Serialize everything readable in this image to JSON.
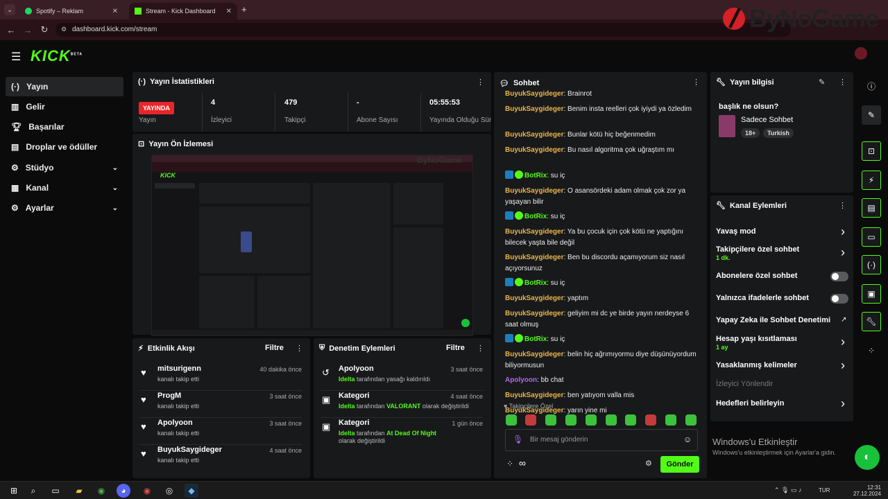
{
  "browser": {
    "tabs": [
      {
        "label": "Spotify – Reklam"
      },
      {
        "label": "Stream - Kick Dashboard"
      }
    ],
    "new_tab": "+",
    "url": "dashboard.kick.com/stream",
    "watermark": "ByNoGame"
  },
  "header": {
    "logo": "KICK",
    "logo_beta": "BETA"
  },
  "sidebar": {
    "items": [
      {
        "label": "Yayın",
        "icon": "broadcast-icon"
      },
      {
        "label": "Gelir",
        "icon": "revenue-icon"
      },
      {
        "label": "Başarılar",
        "icon": "trophy-icon"
      },
      {
        "label": "Droplar ve ödüller",
        "icon": "gift-icon"
      },
      {
        "label": "Stüdyo",
        "icon": "studio-icon"
      },
      {
        "label": "Kanal",
        "icon": "channel-icon"
      },
      {
        "label": "Ayarlar",
        "icon": "gear-icon"
      }
    ]
  },
  "stats": {
    "title": "Yayın İstatistikleri",
    "live_badge": "YAYINDA",
    "stream_label": "Yayın",
    "viewers": {
      "value": "4",
      "label": "İzleyici"
    },
    "followers": {
      "value": "479",
      "label": "Takipçi"
    },
    "subs": {
      "value": "-",
      "label": "Abone Sayısı"
    },
    "uptime": {
      "value": "05:55:53",
      "label": "Yayında Olduğu Süre"
    }
  },
  "preview": {
    "title": "Yayın Ön İzlemesi"
  },
  "activity": {
    "title": "Etkinlik Akışı",
    "filter": "Filtre",
    "items": [
      {
        "name": "mitsurigenn",
        "action": "kanalı takip etti",
        "time": "40 dakika önce"
      },
      {
        "name": "ProgM",
        "action": "kanalı takip etti",
        "time": "3 saat önce"
      },
      {
        "name": "Apolyoon",
        "action": "kanalı takip etti",
        "time": "3 saat önce"
      },
      {
        "name": "BuyukSaygideger",
        "action": "kanalı takip etti",
        "time": "4 saat önce"
      }
    ]
  },
  "moderation": {
    "title": "Denetim Eylemleri",
    "filter": "Filtre",
    "items": [
      {
        "name": "Apolyoon",
        "by": "Idelta",
        "rest": " tarafından yasağı kaldırıldı",
        "highlight": "",
        "tail": "",
        "time": "3 saat önce"
      },
      {
        "name": "Kategori",
        "by": "Idelta",
        "rest": " tarafından ",
        "highlight": "VALORANT",
        "tail": " olarak değiştirildi",
        "time": "4 saat önce"
      },
      {
        "name": "Kategori",
        "by": "Idelta",
        "rest": " tarafından ",
        "highlight": "At Dead Of Night",
        "tail": " olarak değiştirildi",
        "time": "1 gün önce"
      }
    ]
  },
  "chat": {
    "title": "Sohbet",
    "messages": [
      {
        "user": "BuyukSaygideger",
        "text": "Brainrot",
        "type": "u"
      },
      {
        "user": "BuyukSaygideger",
        "text": "Benim insta reelleri çok iyiydi ya özledim",
        "type": "u"
      },
      {
        "user": "BuyukSaygideger",
        "text": "Bunlar kötü hiç beğenmedim",
        "type": "u"
      },
      {
        "user": "BuyukSaygideger",
        "text": "Bu nasıl algoritma çok uğraştım mı",
        "type": "u"
      },
      {
        "user": "BotRix",
        "text": "su iç",
        "type": "b"
      },
      {
        "user": "BuyukSaygideger",
        "text": "O asansördeki adam olmak çok zor ya yaşayan bilir",
        "type": "u"
      },
      {
        "user": "BotRix",
        "text": "su iç",
        "type": "b"
      },
      {
        "user": "BuyukSaygideger",
        "text": "Ya bu çocuk için çok kötü ne yaptığını bilecek yaşta bile değil",
        "type": "u"
      },
      {
        "user": "BuyukSaygideger",
        "text": "Ben bu discordu açamıyorum siz nasıl açıyorsunuz",
        "type": "u"
      },
      {
        "user": "BotRix",
        "text": "su iç",
        "type": "b"
      },
      {
        "user": "BuyukSaygideger",
        "text": "yaptım",
        "type": "u"
      },
      {
        "user": "BuyukSaygideger",
        "text": "geliyim mi dc ye birde yayın nerdeyse 6 saat olmuş",
        "type": "u"
      },
      {
        "user": "BotRix",
        "text": "su iç",
        "type": "b"
      },
      {
        "user": "BuyukSaygideger",
        "text": "belin hiç ağrımıyormu diye düşünüyordum biliyormusun",
        "type": "u"
      },
      {
        "user": "Apolyoon",
        "text": "bb chat",
        "type": "p"
      },
      {
        "user": "BuyukSaygideger",
        "text": "ben yatıyom valla mis",
        "type": "u"
      },
      {
        "user": "BuyukSaygideger",
        "text": "yarın yine mi",
        "type": "u"
      }
    ],
    "followers_only": "Takipçilere Özel",
    "placeholder": "Bir mesaj gönderin",
    "send": "Gönder",
    "infinity": "∞"
  },
  "stream_info": {
    "title": "Yayın bilgisi",
    "stream_title": "başlık ne olsun?",
    "category": "Sadece Sohbet",
    "tags": [
      "18+",
      "Turkish"
    ]
  },
  "channel_actions": {
    "title": "Kanal Eylemleri",
    "items": [
      {
        "label": "Yavaş mod",
        "sub": "",
        "control": "chevron"
      },
      {
        "label": "Takipçilere özel sohbet",
        "sub": "1 dk.",
        "control": "chevron"
      },
      {
        "label": "Abonelere özel sohbet",
        "sub": "",
        "control": "toggle"
      },
      {
        "label": "Yalnızca ifadelerle sohbet",
        "sub": "",
        "control": "toggle"
      },
      {
        "label": "Yapay Zeka ile Sohbet Denetimi",
        "sub": "",
        "control": "external"
      },
      {
        "label": "Hesap yaşı kısıtlaması",
        "sub": "1 ay",
        "control": "chevron"
      },
      {
        "label": "Yasaklanmış kelimeler",
        "sub": "",
        "control": "chevron"
      },
      {
        "label": "İzleyici Yönlendir",
        "sub": "",
        "control": "none"
      },
      {
        "label": "Hedefleri belirleyin",
        "sub": "",
        "control": "chevron"
      }
    ]
  },
  "windows": {
    "activate_title": "Windows'u Etkinleştir",
    "activate_sub": "Windows'u etkinleştirmek için Ayarlar'a gidin.",
    "lang": "TUR",
    "time": "12:31",
    "date": "27.12.2024"
  },
  "colors": {
    "accent": "#53fc18",
    "live": "#e8262a",
    "username": "#eab54b",
    "purple": "#b06af0"
  }
}
